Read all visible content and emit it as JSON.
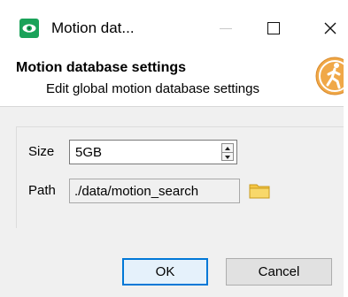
{
  "window": {
    "title": "Motion dat...",
    "icon": "eye-icon",
    "controls": {
      "minimize": "minimize-icon",
      "maximize": "maximize-icon",
      "close_glyph": "✕"
    }
  },
  "header": {
    "title": "Motion database settings",
    "subtitle": "Edit global motion database settings",
    "logo": "walking-person-icon",
    "logo_color": "#f0a848"
  },
  "form": {
    "size": {
      "label": "Size",
      "value": "5GB"
    },
    "path": {
      "label": "Path",
      "value": "./data/motion_search",
      "browse_icon": "folder-icon"
    }
  },
  "buttons": {
    "ok": "OK",
    "cancel": "Cancel"
  },
  "colors": {
    "accent": "#0078d7",
    "dialog_bg": "#f0f0f0",
    "app_icon": "#1aa259"
  }
}
